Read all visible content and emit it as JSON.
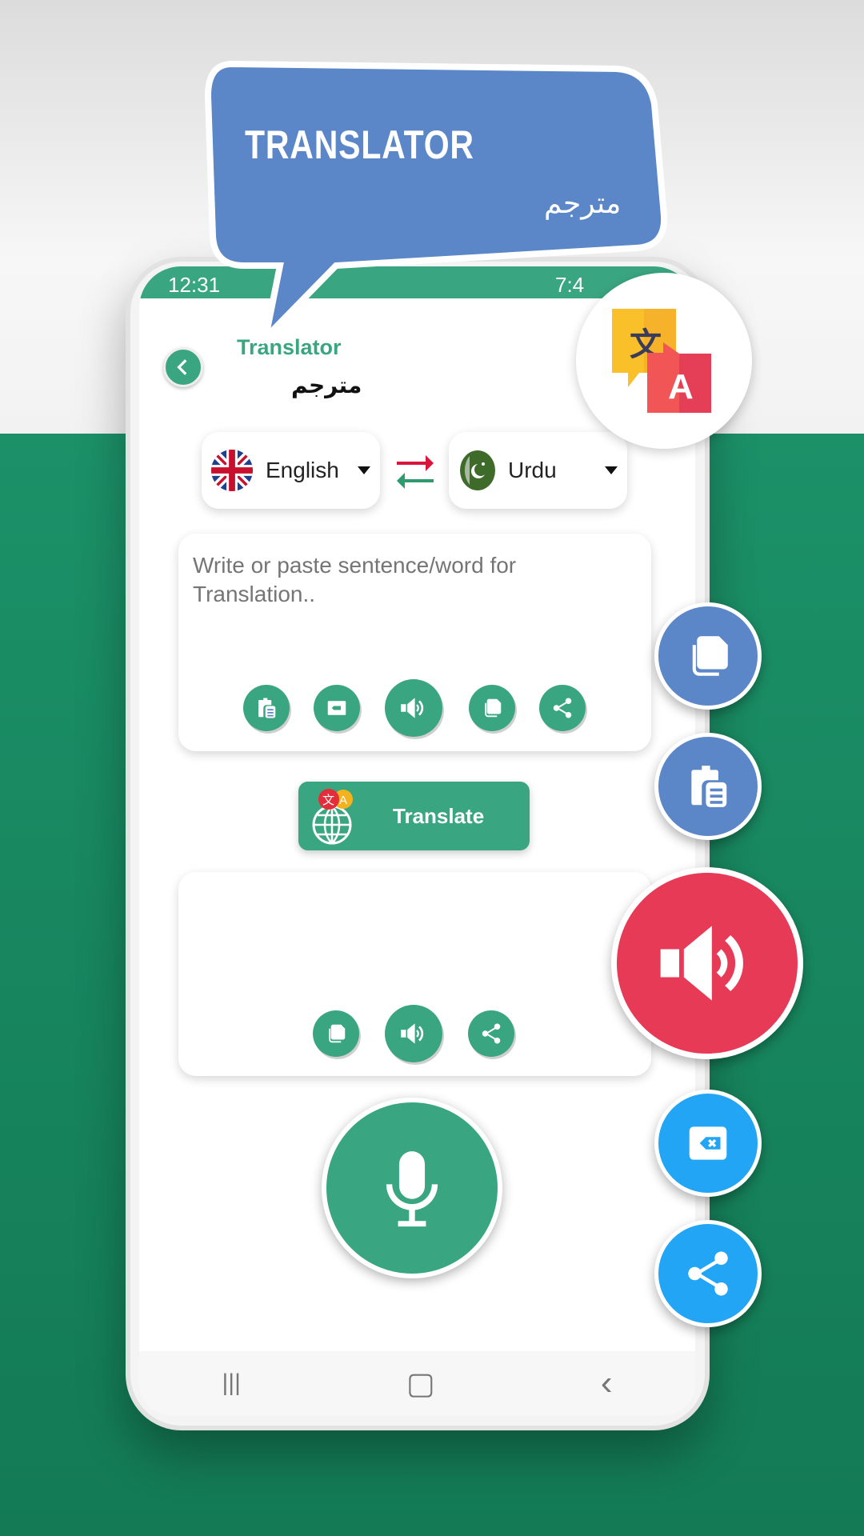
{
  "banner": {
    "title": "TRANSLATOR",
    "subtitle": "مترجم"
  },
  "status": {
    "time": "12:31",
    "right": "7:4"
  },
  "header": {
    "title": "Translator",
    "subtitle": "مترجم"
  },
  "languages": {
    "source": "English",
    "target": "Urdu"
  },
  "input": {
    "placeholder": "Write or paste sentence/word for Translation..",
    "value": ""
  },
  "translate_button": "Translate",
  "colors": {
    "primary": "#3aa681",
    "bubble": "#5b86c8",
    "speak": "#e63a57",
    "action_blue": "#22a5f5",
    "background_green": "#1a8a62"
  },
  "icons": {
    "input_actions": [
      "paste-icon",
      "clear-icon",
      "speaker-icon",
      "copy-icon",
      "share-icon"
    ],
    "output_actions": [
      "copy-icon",
      "speaker-icon",
      "share-icon"
    ],
    "floating": [
      "copy-icon",
      "paste-icon",
      "speaker-icon",
      "backspace-icon",
      "share-icon"
    ]
  },
  "nav": {
    "recent": "|||",
    "home": "▢",
    "back": "‹"
  }
}
